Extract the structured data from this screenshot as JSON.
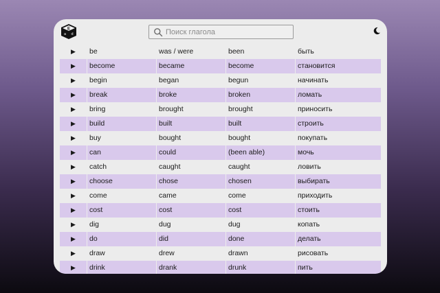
{
  "app": {
    "logo_icon": "dice-logo-icon",
    "theme_icon": "moon-icon"
  },
  "search": {
    "placeholder": "Поиск глагола",
    "value": ""
  },
  "colors": {
    "accent_row": "#d9c9ec",
    "card": "#ececec"
  },
  "verbs": [
    {
      "base": "be",
      "past": "was / were",
      "participle": "been",
      "translation": "быть"
    },
    {
      "base": "become",
      "past": "became",
      "participle": "become",
      "translation": "становится"
    },
    {
      "base": "begin",
      "past": "began",
      "participle": "begun",
      "translation": "начинать"
    },
    {
      "base": "break",
      "past": "broke",
      "participle": "broken",
      "translation": "ломать"
    },
    {
      "base": "bring",
      "past": "brought",
      "participle": "brought",
      "translation": "приносить"
    },
    {
      "base": "build",
      "past": "built",
      "participle": "built",
      "translation": "строить"
    },
    {
      "base": "buy",
      "past": "bought",
      "participle": "bought",
      "translation": "покупать"
    },
    {
      "base": "can",
      "past": "could",
      "participle": "(been able)",
      "translation": "мочь"
    },
    {
      "base": "catch",
      "past": "caught",
      "participle": "caught",
      "translation": "ловить"
    },
    {
      "base": "choose",
      "past": "chose",
      "participle": "chosen",
      "translation": "выбирать"
    },
    {
      "base": "come",
      "past": "came",
      "participle": "come",
      "translation": "приходить"
    },
    {
      "base": "cost",
      "past": "cost",
      "participle": "cost",
      "translation": "стоить"
    },
    {
      "base": "dig",
      "past": "dug",
      "participle": "dug",
      "translation": "копать"
    },
    {
      "base": "do",
      "past": "did",
      "participle": "done",
      "translation": "делать"
    },
    {
      "base": "draw",
      "past": "drew",
      "participle": "drawn",
      "translation": "рисовать"
    },
    {
      "base": "drink",
      "past": "drank",
      "participle": "drunk",
      "translation": "пить"
    }
  ]
}
